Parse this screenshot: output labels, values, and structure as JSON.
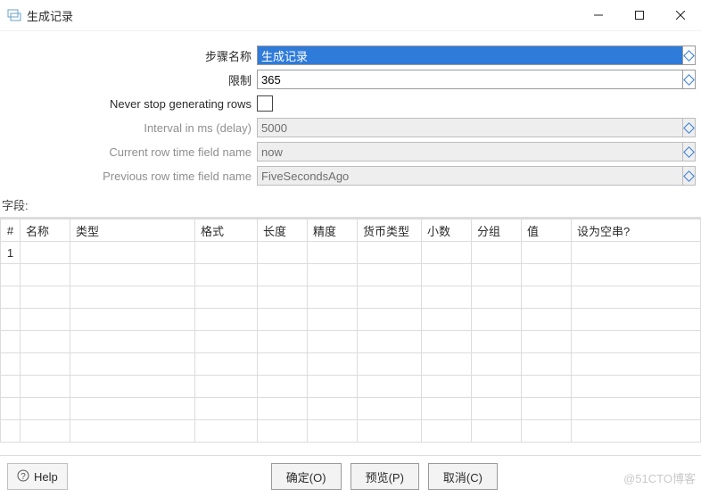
{
  "titlebar": {
    "title": "生成记录"
  },
  "form": {
    "step_label": "步骤名称",
    "step_value": "生成记录",
    "limit_label": "限制",
    "limit_value": "365",
    "never_stop_label": "Never stop generating rows",
    "interval_label": "Interval in ms (delay)",
    "interval_value": "5000",
    "current_row_label": "Current row time field name",
    "current_row_value": "now",
    "prev_row_label": "Previous row time field name",
    "prev_row_value": "FiveSecondsAgo"
  },
  "fields_section_label": "字段:",
  "columns": {
    "num": "#",
    "name": "名称",
    "type": "类型",
    "format": "格式",
    "length": "长度",
    "precision": "精度",
    "currency": "货币类型",
    "decimal": "小数",
    "group": "分组",
    "value": "值",
    "setempty": "设为空串?"
  },
  "rows": {
    "first_index": "1"
  },
  "buttons": {
    "help": "Help",
    "ok": "确定(O)",
    "preview": "预览(P)",
    "cancel": "取消(C)"
  },
  "watermark": "@51CTO博客"
}
